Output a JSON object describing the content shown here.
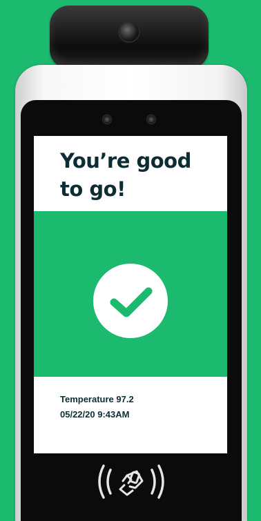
{
  "colors": {
    "background": "#1bba6f",
    "status_panel": "#1bba6f",
    "text": "#0e2c33"
  },
  "screen": {
    "headline_line1": "You’re good",
    "headline_line2": "to go!",
    "status_icon": "checkmark-icon",
    "temperature_text": "Temperature 97.2",
    "datetime_text": "05/22/20 9:43AM"
  },
  "device": {
    "reader_icon": "nfc-contactless-icon"
  }
}
